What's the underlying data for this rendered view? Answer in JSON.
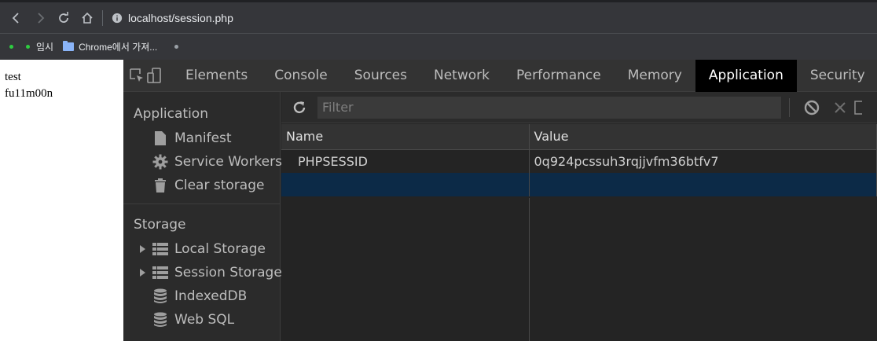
{
  "browser": {
    "url": "localhost/session.php",
    "bookmarks": [
      {
        "label": "임시"
      },
      {
        "label": "Chrome에서 가져..."
      }
    ]
  },
  "page": {
    "lines": [
      "test",
      "fu11m00n"
    ]
  },
  "devtools": {
    "tabs": [
      "Elements",
      "Console",
      "Sources",
      "Network",
      "Performance",
      "Memory",
      "Application",
      "Security"
    ],
    "active_tab": "Application",
    "sidebar": {
      "application_header": "Application",
      "application_items": [
        "Manifest",
        "Service Workers",
        "Clear storage"
      ],
      "storage_header": "Storage",
      "storage_items": [
        "Local Storage",
        "Session Storage",
        "IndexedDB",
        "Web SQL"
      ]
    },
    "filter_placeholder": "Filter",
    "table": {
      "columns": [
        "Name",
        "Value"
      ],
      "rows": [
        {
          "name": "PHPSESSID",
          "value": "0q924pcssuh3rqjjvfm36btfv7"
        }
      ]
    },
    "colors": {
      "active_tab_bg": "#000000",
      "selected_row": "#0c2a47"
    }
  }
}
